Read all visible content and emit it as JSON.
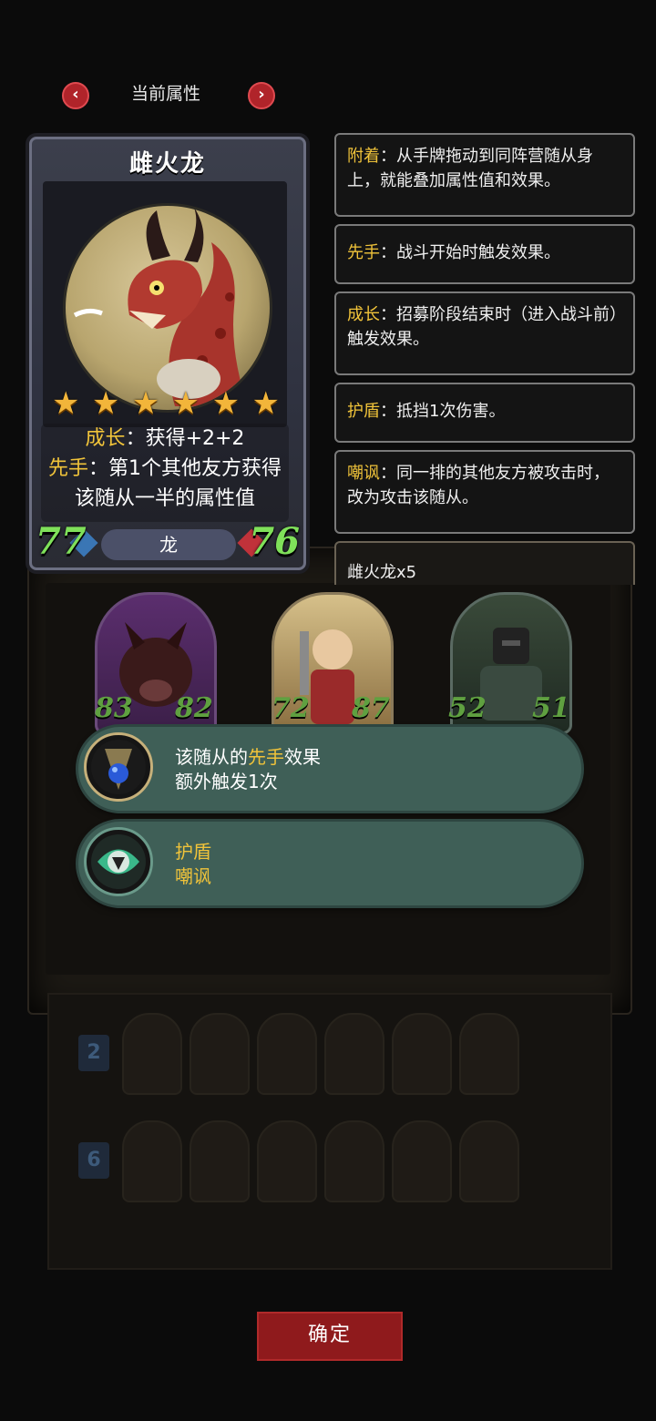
{
  "header": {
    "title": "当前属性"
  },
  "card": {
    "name": "雌火龙",
    "stars": 6,
    "desc": {
      "growth_kw": "成长",
      "growth_text": "：获得+2+2",
      "battlecry_kw": "先手",
      "battlecry_text": "：第1个其他友方获得该随从一半的属性值"
    },
    "attack": "77",
    "health": "76",
    "tribe": "龙"
  },
  "tooltips": [
    {
      "label": "附着",
      "text": "：从手牌拖动到同阵营随从身上，就能叠加属性值和效果。"
    },
    {
      "label": "先手",
      "text": "：战斗开始时触发效果。"
    },
    {
      "label": "成长",
      "text": "：招募阶段结束时（进入战斗前）触发效果。"
    },
    {
      "label": "护盾",
      "text": "：抵挡1次伤害。"
    },
    {
      "label": "嘲讽",
      "text": "：同一排的其他友方被攻击时，改为攻击该随从。"
    }
  ],
  "stack_label": "雌火龙x5",
  "board": [
    {
      "attack": "83",
      "health": "82"
    },
    {
      "attack": "72",
      "health": "87"
    },
    {
      "attack": "52",
      "health": "51"
    }
  ],
  "banners": {
    "battlecry": {
      "pre": "该随从的",
      "kw": "先手",
      "post": "效果",
      "line2": "额外触发1次"
    },
    "keywords": {
      "line1": "护盾",
      "line2": "嘲讽"
    }
  },
  "tray_badges": [
    "2",
    "6"
  ],
  "confirm_label": "确定",
  "colors": {
    "keyword": "#f0c33a",
    "stat_green": "#7fe05a",
    "confirm": "#8f1a1c",
    "banner": "#3f5f57"
  }
}
